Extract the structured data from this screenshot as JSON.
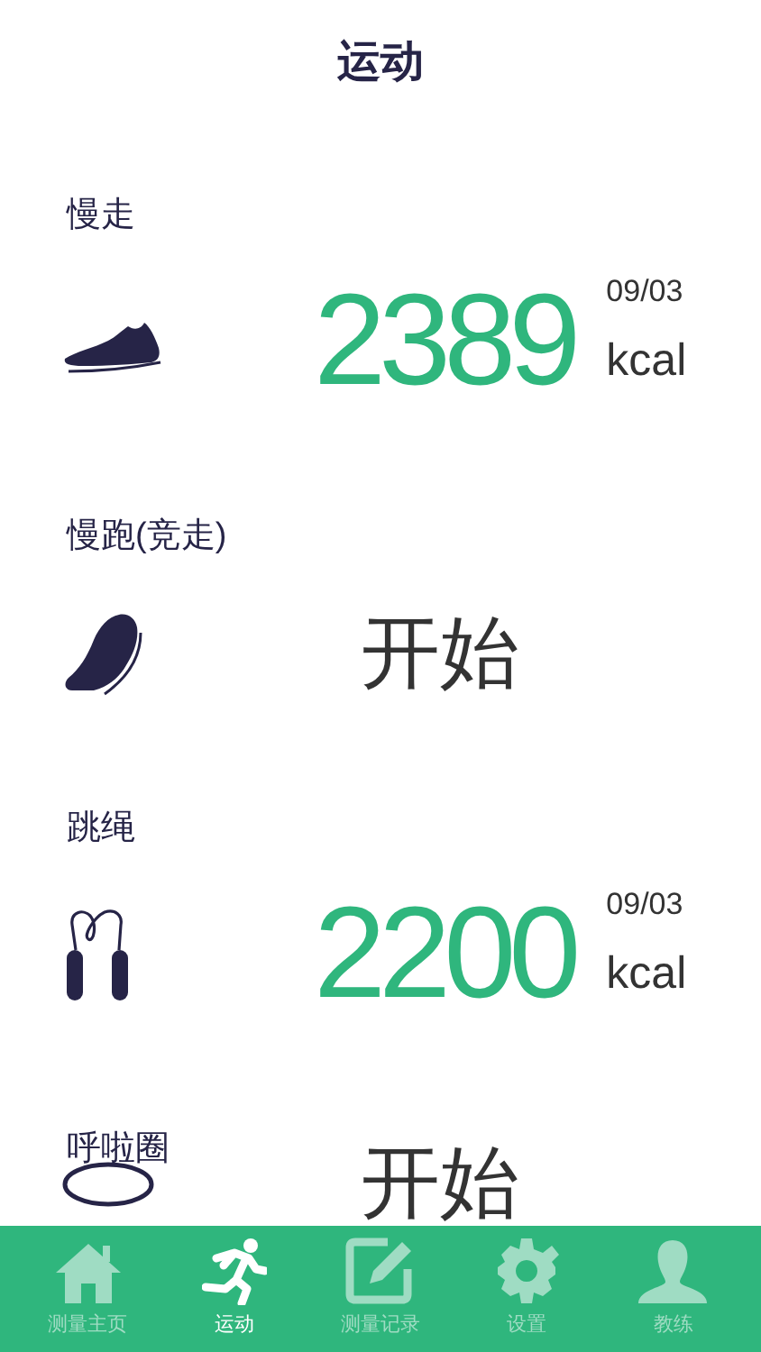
{
  "header": {
    "title": "运动"
  },
  "activities": [
    {
      "name": "慢走",
      "kind": "record",
      "value": "2389",
      "date": "09/03",
      "unit": "kcal"
    },
    {
      "name": "慢跑(竞走)",
      "kind": "start",
      "button": "开始"
    },
    {
      "name": "跳绳",
      "kind": "record",
      "value": "2200",
      "date": "09/03",
      "unit": "kcal"
    },
    {
      "name": "呼啦圈",
      "kind": "start",
      "button": "开始"
    }
  ],
  "tab_bar": [
    {
      "label": "测量主页",
      "selected": false
    },
    {
      "label": "运动",
      "selected": true
    },
    {
      "label": "测量记录",
      "selected": false
    },
    {
      "label": "设置",
      "selected": false
    },
    {
      "label": "教练",
      "selected": false
    }
  ]
}
